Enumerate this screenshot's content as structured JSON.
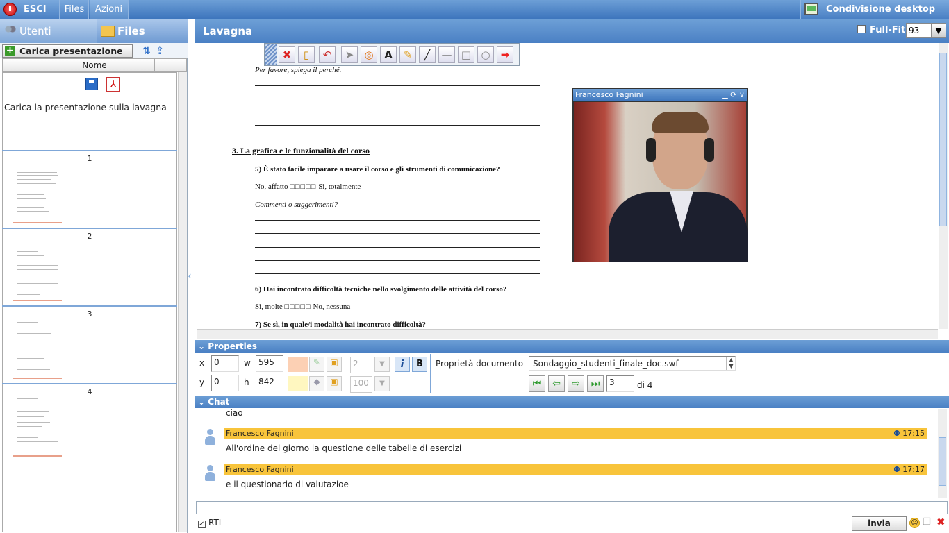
{
  "topbar": {
    "exit_label": "ESCI",
    "files_label": "Files",
    "azioni_label": "Azioni",
    "share_label": "Condivisione desktop"
  },
  "left": {
    "tab_users": "Utenti",
    "tab_files": "Files",
    "upload_label": "Carica presentazione",
    "column_name": "Nome",
    "upload_hint": "Carica la presentazione sulla lavagna",
    "pages": [
      "1",
      "2",
      "3",
      "4"
    ]
  },
  "board": {
    "title": "Lavagna",
    "fullfit_label": "Full-Fit",
    "zoom": "93",
    "doc": {
      "q_explain": "Per favore, spiega il perché.",
      "section3": "3. La grafica e le funzionalità del corso",
      "q5": "5) È stato facile imparare a usare il corso e gli strumenti di comunicazione?",
      "q5_scale_left": "No, affatto",
      "q5_scale_right": "Sì, totalmente",
      "comments": "Commenti o suggerimenti?",
      "q6": "6) Hai incontrato difficoltà tecniche nello svolgimento delle attività del corso?",
      "q6_scale_left": "Sì, molte",
      "q6_scale_right": "No, nessuna",
      "q7": "7) Se sì, in quale/i modalità hai incontrato difficoltà?"
    },
    "video_name": "Francesco Fagnini"
  },
  "properties": {
    "header": "Properties",
    "x_label": "x",
    "x_value": "0",
    "y_label": "y",
    "y_value": "0",
    "w_label": "w",
    "w_value": "595",
    "h_label": "h",
    "h_value": "842",
    "stroke_value": "2",
    "opacity_value": "100",
    "italic_label": "i",
    "bold_label": "B",
    "doc_props_label": "Proprietà documento",
    "doc_file": "Sondaggio_studenti_finale_doc.swf",
    "page_value": "3",
    "page_total": "di 4"
  },
  "chat": {
    "header": "Chat",
    "prev_text": "ciao",
    "messages": [
      {
        "user": "Francesco Fagnini",
        "time": "17:15",
        "text": "All'ordine del giorno la questione delle tabelle di esercizi"
      },
      {
        "user": "Francesco Fagnini",
        "time": "17:17",
        "text": "e il questionario di valutazioe"
      }
    ],
    "rtl_label": "RTL",
    "send_label": "invia"
  },
  "colors": {
    "header_blue": "#4a80c4",
    "chat_highlight": "#f8c43b",
    "fill_color": "#fcd0b4",
    "stroke_color": "#fff7c0"
  }
}
